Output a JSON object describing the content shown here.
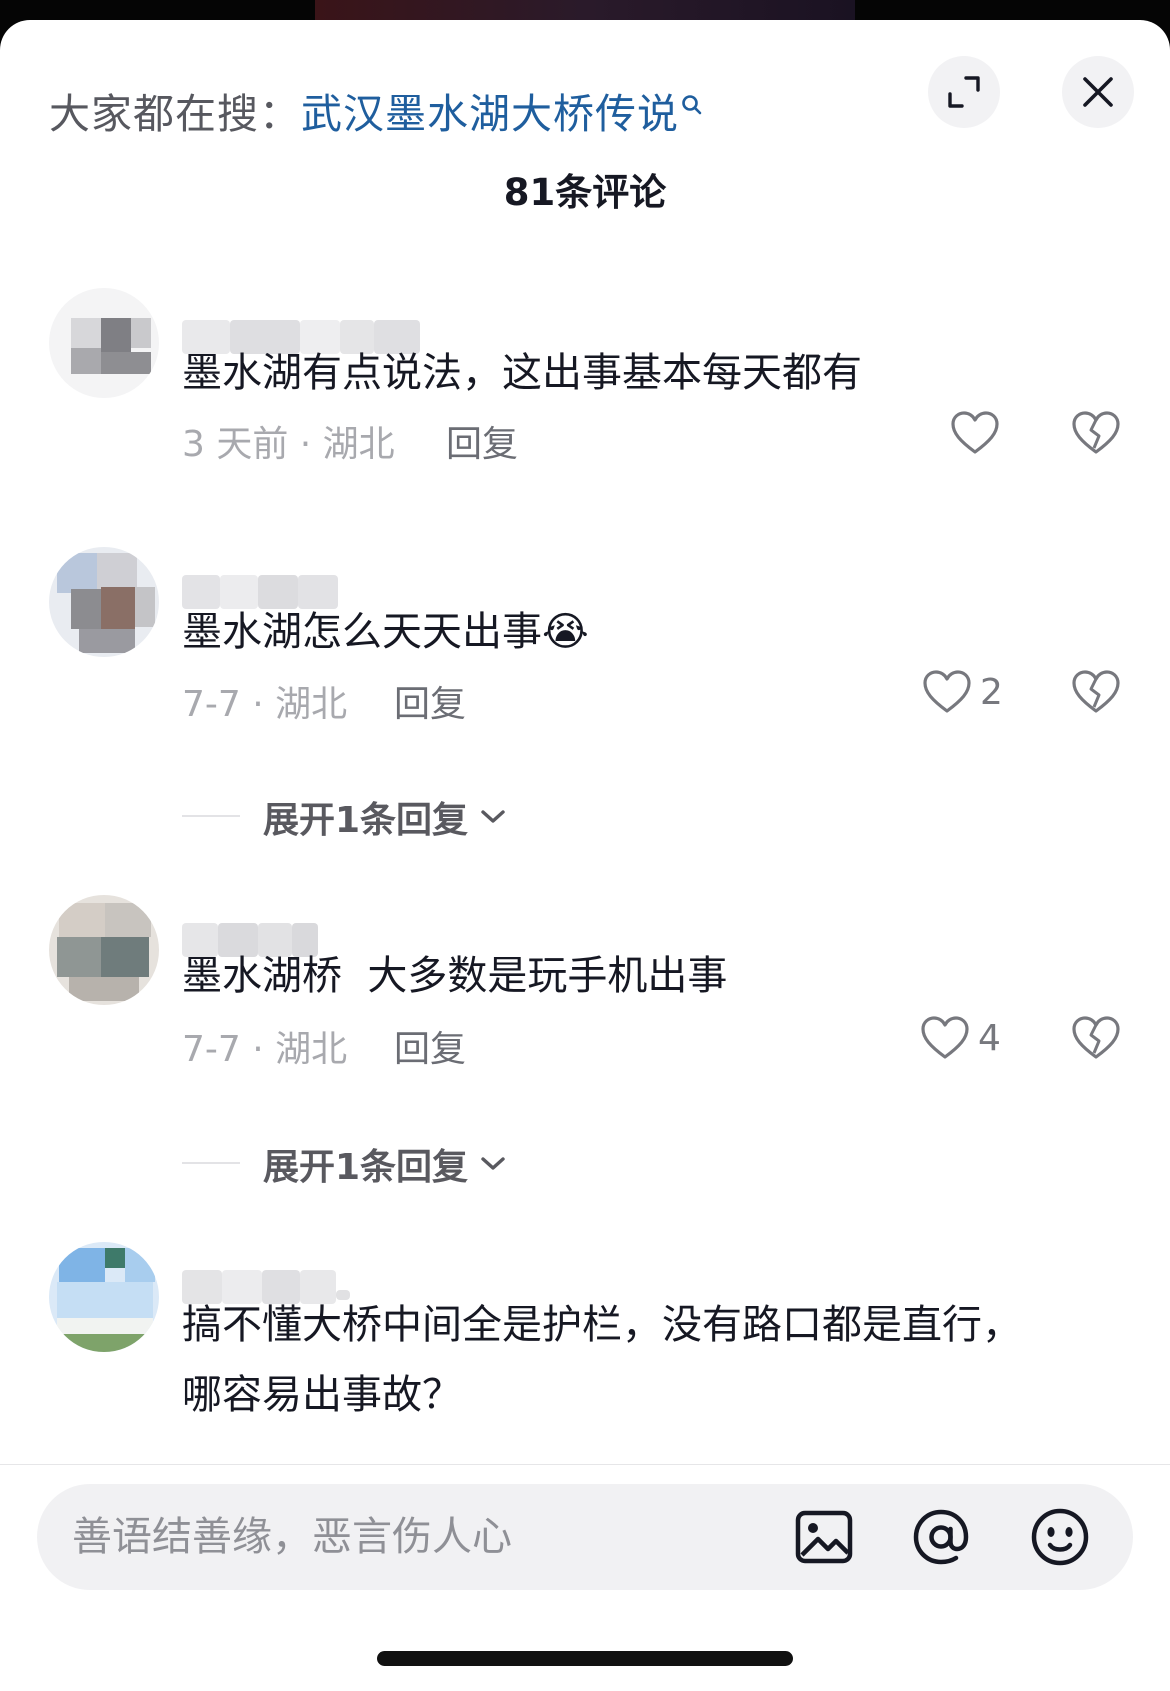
{
  "header": {
    "search_prefix": "大家都在搜：",
    "search_term": "武汉墨水湖大桥传说",
    "comment_count_title": "81条评论",
    "expand_icon": "expand-icon",
    "close_icon": "close-icon"
  },
  "comments": [
    {
      "text": "墨水湖有点说法，这出事基本每天都有",
      "meta": "3 天前 · 湖北",
      "reply_label": "回复",
      "like_count": "",
      "expand_label": ""
    },
    {
      "text": "墨水湖怎么天天出事",
      "emoji": "😭",
      "meta": "7-7 · 湖北",
      "reply_label": "回复",
      "like_count": "2",
      "expand_label": "展开1条回复"
    },
    {
      "text": "墨水湖桥  大多数是玩手机出事",
      "meta": "7-7 · 湖北",
      "reply_label": "回复",
      "like_count": "4",
      "expand_label": "展开1条回复"
    },
    {
      "text_line1": "搞不懂大桥中间全是护栏，没有路口都是直行，",
      "text_line2": "哪容易出事故？"
    }
  ],
  "input_bar": {
    "placeholder": "善语结善缘，恶言伤人心",
    "icons": [
      "image-icon",
      "at-icon",
      "emoji-icon"
    ]
  },
  "colors": {
    "search_term": "#1f5e9e",
    "meta_gray": "#a8a9ae",
    "text_dark": "#161823"
  }
}
